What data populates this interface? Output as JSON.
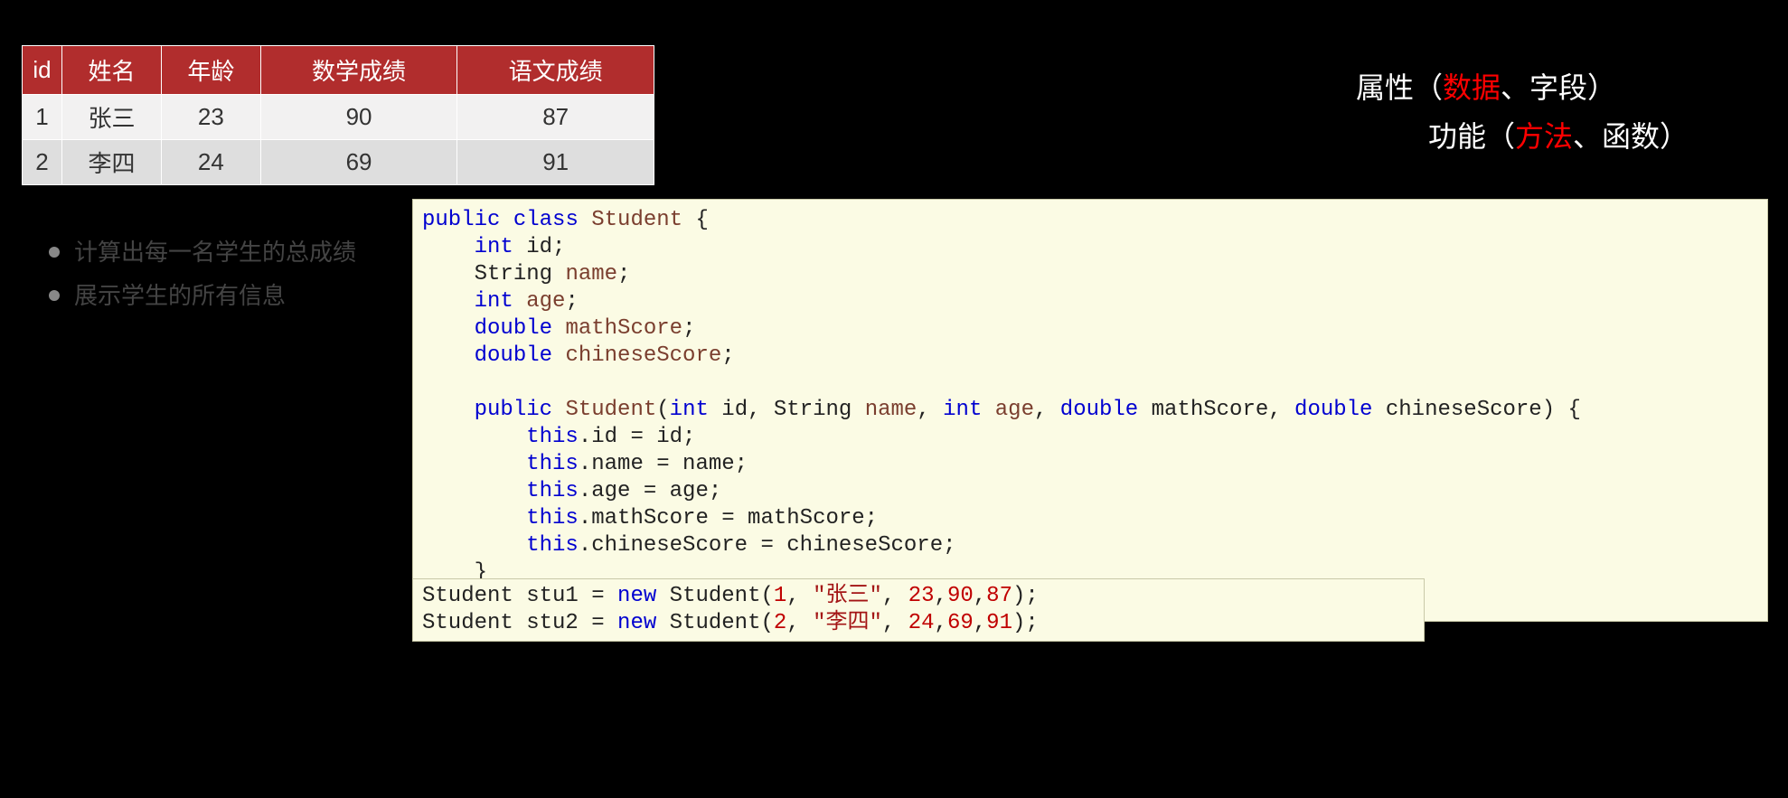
{
  "table": {
    "headers": [
      "id",
      "姓名",
      "年龄",
      "数学成绩",
      "语文成绩"
    ],
    "rows": [
      [
        "1",
        "张三",
        "23",
        "90",
        "87"
      ],
      [
        "2",
        "李四",
        "24",
        "69",
        "91"
      ]
    ]
  },
  "right": {
    "line1_prefix": "属性（",
    "line1_hl": "数据",
    "line1_suffix": "、字段）",
    "line2_prefix": "功能（",
    "line2_hl": "方法",
    "line2_suffix": "、函数）"
  },
  "tasks": {
    "item1": "计算出每一名学生的总成绩",
    "item2": "展示学生的所有信息"
  },
  "code1": {
    "l1_a": "public",
    "l1_b": "class",
    "l1_c": "Student",
    "l1_d": " {",
    "l2_a": "int",
    "l2_b": " id;",
    "l3_a": "String ",
    "l3_b": "name",
    "l3_c": ";",
    "l4_a": "int",
    "l4_b": " ",
    "l4_c": "age",
    "l4_d": ";",
    "l5_a": "double",
    "l5_b": " ",
    "l5_c": "mathScore",
    "l5_d": ";",
    "l6_a": "double",
    "l6_b": " ",
    "l6_c": "chineseScore",
    "l6_d": ";",
    "l8_a": "public",
    "l8_b": " ",
    "l8_c": "Student",
    "l8_d": "(",
    "l8_e": "int",
    "l8_f": " id, String ",
    "l8_g": "name",
    "l8_h": ", ",
    "l8_i": "int",
    "l8_j": " ",
    "l8_k": "age",
    "l8_l": ", ",
    "l8_m": "double",
    "l8_n": " mathScore, ",
    "l8_o": "double",
    "l8_p": " chineseScore) {",
    "l9_a": "this",
    "l9_b": ".id = id;",
    "l10_a": "this",
    "l10_b": ".name = name;",
    "l11_a": "this",
    "l11_b": ".age = age;",
    "l12_a": "this",
    "l12_b": ".mathScore = mathScore;",
    "l13_a": "this",
    "l13_b": ".chineseScore = chineseScore;",
    "l14": "    }",
    "l15": "}"
  },
  "code2": {
    "l1_a": "Student stu1 = ",
    "l1_b": "new",
    "l1_c": " Student(",
    "l1_d": "1",
    "l1_e": ", ",
    "l1_f": "\"张三\"",
    "l1_g": ", ",
    "l1_h": "23",
    "l1_i": ",",
    "l1_j": "90",
    "l1_k": ",",
    "l1_l": "87",
    "l1_m": ");",
    "l2_a": "Student stu2 = ",
    "l2_b": "new",
    "l2_c": " Student(",
    "l2_d": "2",
    "l2_e": ", ",
    "l2_f": "\"李四\"",
    "l2_g": ", ",
    "l2_h": "24",
    "l2_i": ",",
    "l2_j": "69",
    "l2_k": ",",
    "l2_l": "91",
    "l2_m": ");"
  }
}
